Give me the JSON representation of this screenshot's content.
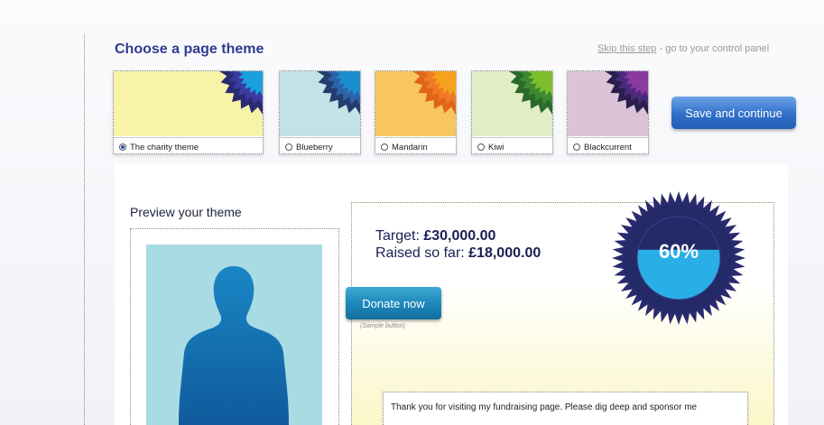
{
  "header": {
    "title": "Choose a page theme",
    "skip_link": "Skip this step",
    "skip_suffix": " - go to your control panel"
  },
  "themes": [
    {
      "label": "The charity theme",
      "selected": true,
      "bg": "#f8f3a6",
      "colors": [
        "#2a2a72",
        "#3a3aa0",
        "#1aa0dc"
      ]
    },
    {
      "label": "Blueberry",
      "selected": false,
      "bg": "#c2e2e5",
      "colors": [
        "#243c6e",
        "#2c62a8",
        "#1a8fd0"
      ]
    },
    {
      "label": "Mandarin",
      "selected": false,
      "bg": "#f7c65c",
      "colors": [
        "#e0641a",
        "#f07a22",
        "#f5a21e"
      ]
    },
    {
      "label": "Kiwi",
      "selected": false,
      "bg": "#e0edc5",
      "colors": [
        "#2b6a2b",
        "#3d8a32",
        "#7cbf2a"
      ]
    },
    {
      "label": "Blackcurrent",
      "selected": false,
      "bg": "#dbc4d8",
      "colors": [
        "#2a1f4e",
        "#4c2a7a",
        "#8a3aa0"
      ]
    }
  ],
  "save_button": "Save and continue",
  "preview": {
    "title": "Preview your theme",
    "target_label": "Target: ",
    "target_value": "£30,000.00",
    "raised_label": "Raised so far: ",
    "raised_value": "£18,000.00",
    "progress_percent": 60,
    "progress_text": "60%",
    "donate_button": "Donate now",
    "sample_caption": "(Sample button)",
    "message": "Thank you for visiting my fundraising page. Please dig deep and sponsor me"
  },
  "colors": {
    "heading": "#2f3c8f",
    "badge_dark": "#2a2a6e",
    "badge_fill": "#2aaee6",
    "photo_bg": "#a8dbe3",
    "silhouette": "#1a74b8"
  }
}
